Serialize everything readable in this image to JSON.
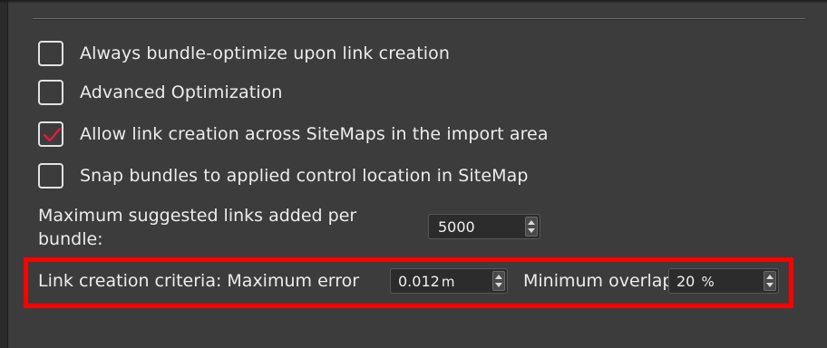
{
  "options": {
    "bundle_optimize": {
      "label": "Always bundle-optimize upon link creation",
      "checked": false
    },
    "advanced_optimization": {
      "label": "Advanced Optimization",
      "checked": false
    },
    "allow_link_across_sitemaps": {
      "label": "Allow link creation across SiteMaps in the import area",
      "checked": true
    },
    "snap_bundles": {
      "label": "Snap bundles to applied control location in SiteMap",
      "checked": false
    }
  },
  "max_suggested_links": {
    "label_line1": "Maximum suggested links added per",
    "label_line2": "bundle:",
    "value": "5000"
  },
  "link_criteria": {
    "label": "Link creation criteria: Maximum error",
    "max_error_value": "0.012",
    "max_error_unit": "m",
    "min_overlap_label": "Minimum overlap",
    "min_overlap_value": "20",
    "min_overlap_unit": "%"
  },
  "colors": {
    "highlight": "#ff0000",
    "checkmark": "#e8193c",
    "panel": "#3c3c3c"
  }
}
